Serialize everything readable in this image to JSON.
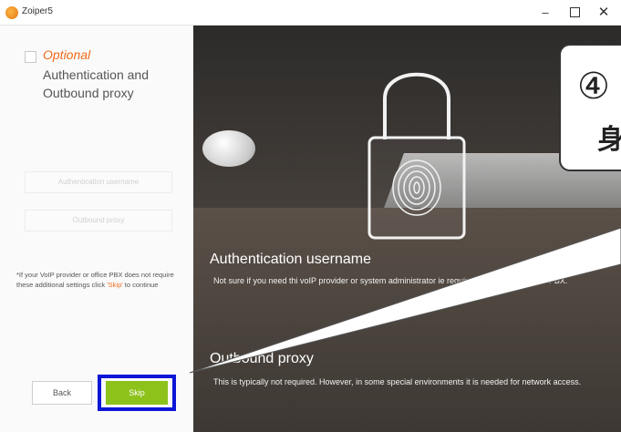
{
  "window": {
    "title": "Zoiper5",
    "minimize": "–",
    "close": "✕"
  },
  "left": {
    "optional": "Optional",
    "subtitle": "Authentication and Outbound proxy",
    "auth_placeholder": "Authentication username",
    "proxy_placeholder": "Outbound proxy",
    "note_pre": "*If your VoIP provider or office PBX does not require these additional settings click ",
    "note_skip": "'Skip'",
    "note_post": " to continue",
    "back_label": "Back",
    "skip_label": "Skip"
  },
  "right": {
    "heading1": "Authentication username",
    "body1": "Not sure if you need thi               voIP provider or system administrator        ie requirements for your office PBX.",
    "heading2": "Outbound proxy",
    "body2": "This is typically not required. However, in some special environments it is needed for network access."
  },
  "callout": {
    "line1": "④",
    "line2": "身"
  },
  "colors": {
    "accent_orange": "#f06a1a",
    "skip_green": "#8dc21a",
    "highlight_blue": "#0b16d6"
  }
}
